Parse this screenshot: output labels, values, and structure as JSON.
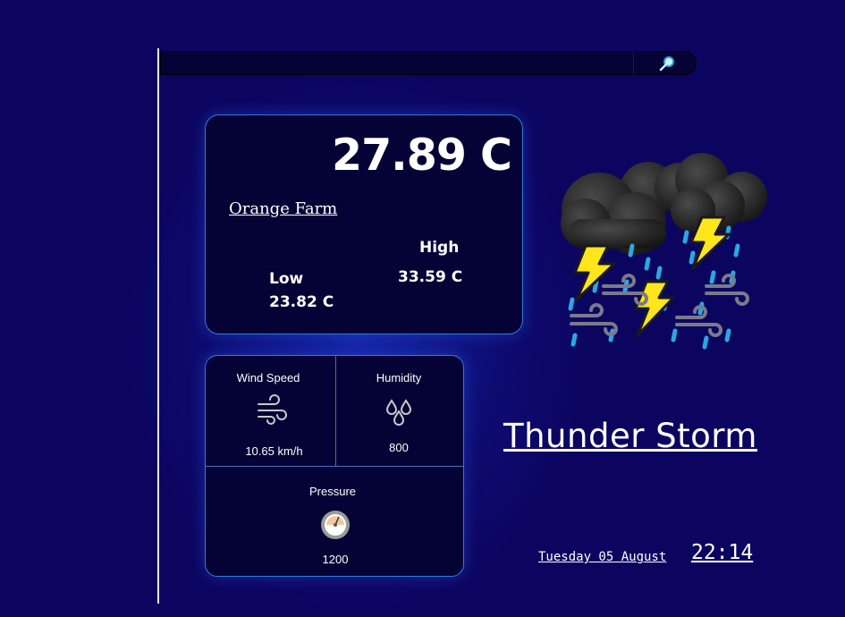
{
  "search": {
    "placeholder": "",
    "value": "",
    "icon": "search-icon"
  },
  "current": {
    "temperature": "27.89 C",
    "city": "Orange Farm",
    "high_label": "High",
    "high_value": "33.59 C",
    "low_label": "Low",
    "low_value": "23.82 C"
  },
  "stats": {
    "wind_label": "Wind Speed",
    "wind_value": "10.65 km/h",
    "wind_icon": "wind-icon",
    "humidity_label": "Humidity",
    "humidity_value": "800",
    "humidity_icon": "droplets-icon",
    "pressure_label": "Pressure",
    "pressure_value": "1200",
    "pressure_icon": "barometer-icon"
  },
  "condition": {
    "description": "Thunder Storm",
    "icon": "thunderstorm-icon"
  },
  "datetime": {
    "date": "Tuesday 05 August",
    "time": "22:14"
  },
  "colors": {
    "background": "#0c0560",
    "card": "#050335",
    "card_border": "#2e7be0",
    "text": "#ffffff"
  }
}
